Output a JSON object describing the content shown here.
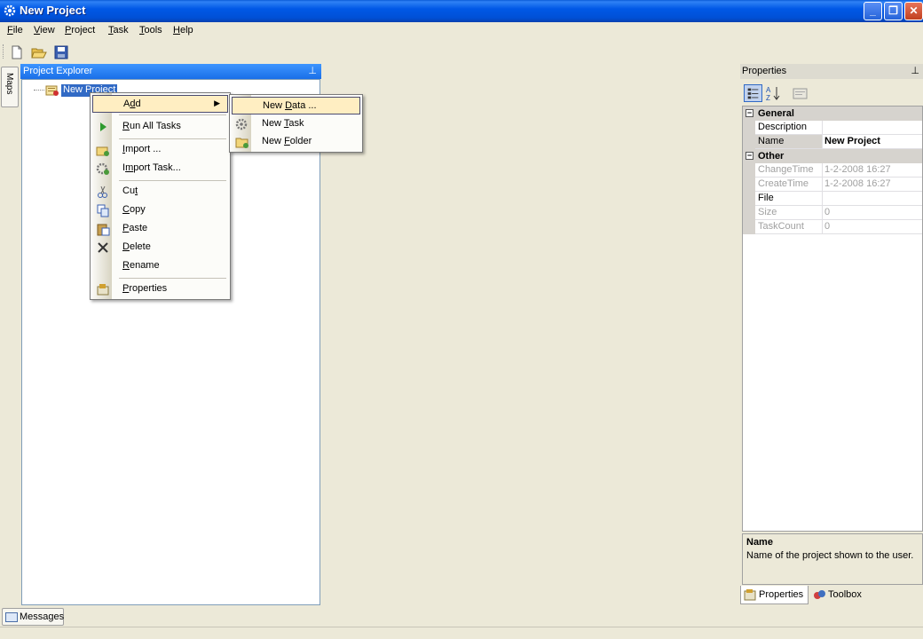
{
  "window": {
    "title": "New Project"
  },
  "menubar": [
    "File",
    "View",
    "Project",
    "Task",
    "Tools",
    "Help"
  ],
  "toolbar": {
    "buttons": [
      "new-file-icon",
      "open-folder-icon",
      "save-icon"
    ]
  },
  "sidetab": {
    "label": "Maps"
  },
  "project_explorer": {
    "title": "Project Explorer",
    "tree": [
      {
        "label": "New Project",
        "selected": true
      }
    ]
  },
  "context_menu": {
    "items": [
      {
        "pre": "A",
        "u": "d",
        "post": "d",
        "highlighted": true,
        "submenu": true
      },
      {
        "pre": "",
        "u": "R",
        "post": "un All Tasks",
        "icon": "play-icon"
      },
      {
        "pre": "",
        "u": "I",
        "post": "mport ...",
        "icon": "import-icon"
      },
      {
        "pre": "I",
        "u": "m",
        "post": "port Task...",
        "icon": "import-task-icon"
      },
      {
        "pre": "Cu",
        "u": "t",
        "post": "",
        "icon": "cut-icon"
      },
      {
        "pre": "",
        "u": "C",
        "post": "opy",
        "icon": "copy-icon"
      },
      {
        "pre": "",
        "u": "P",
        "post": "aste",
        "icon": "paste-icon"
      },
      {
        "pre": "",
        "u": "D",
        "post": "elete",
        "icon": "delete-icon"
      },
      {
        "pre": "",
        "u": "R",
        "post": "ename",
        "icon": ""
      },
      {
        "pre": "",
        "u": "P",
        "post": "roperties",
        "icon": "properties-icon"
      }
    ]
  },
  "submenu": {
    "items": [
      {
        "pre": "New ",
        "u": "D",
        "post": "ata ...",
        "highlighted": true,
        "icon": ""
      },
      {
        "pre": "New ",
        "u": "T",
        "post": "ask",
        "icon": "task-icon"
      },
      {
        "pre": "New ",
        "u": "F",
        "post": "older",
        "icon": "folder-icon"
      }
    ]
  },
  "properties": {
    "title": "Properties",
    "categories": [
      {
        "name": "General",
        "rows": [
          {
            "key": "Description",
            "value": "",
            "readonly": false
          },
          {
            "key": "Name",
            "value": "New Project",
            "readonly": false,
            "selected": true,
            "bold": true
          }
        ]
      },
      {
        "name": "Other",
        "rows": [
          {
            "key": "ChangeTime",
            "value": "1-2-2008 16:27",
            "readonly": true
          },
          {
            "key": "CreateTime",
            "value": "1-2-2008 16:27",
            "readonly": true
          },
          {
            "key": "File",
            "value": "",
            "readonly": false
          },
          {
            "key": "Size",
            "value": "0",
            "readonly": true
          },
          {
            "key": "TaskCount",
            "value": "0",
            "readonly": true
          }
        ]
      }
    ],
    "description": {
      "heading": "Name",
      "text": "Name of the project shown to the user."
    },
    "tabs": [
      {
        "label": "Properties",
        "active": true,
        "icon": "properties-icon"
      },
      {
        "label": "Toolbox",
        "active": false,
        "icon": "toolbox-icon"
      }
    ]
  },
  "bottom": {
    "messages_tab": "Messages"
  }
}
